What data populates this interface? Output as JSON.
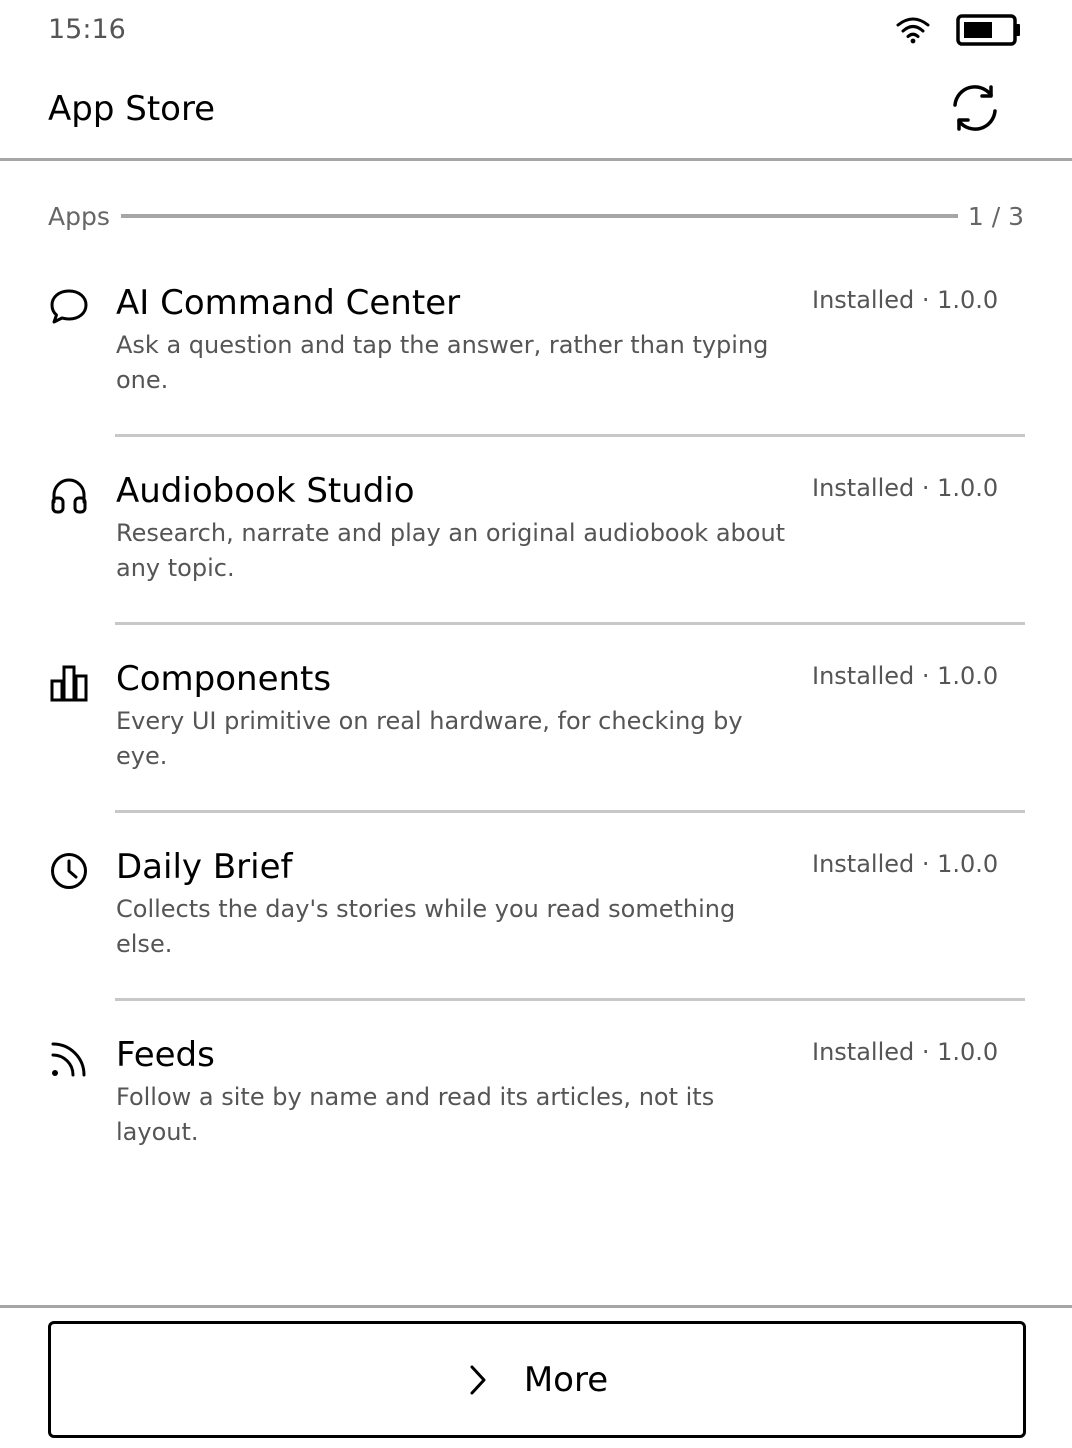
{
  "status_bar": {
    "time": "15:16",
    "wifi_icon": "wifi-icon",
    "battery_icon": "battery-icon"
  },
  "header": {
    "title": "App Store",
    "refresh_icon": "refresh-icon"
  },
  "section": {
    "label": "Apps",
    "page_indicator": "1 / 3"
  },
  "apps": [
    {
      "name": "AI Command Center",
      "description": "Ask a question and tap the answer, rather than typing one.",
      "status": "Installed · 1.0.0",
      "icon": "chat-bubble-icon"
    },
    {
      "name": "Audiobook Studio",
      "description": "Research, narrate and play an original audiobook about any topic.",
      "status": "Installed · 1.0.0",
      "icon": "headphones-icon"
    },
    {
      "name": "Components",
      "description": "Every UI primitive on real hardware, for checking by eye.",
      "status": "Installed · 1.0.0",
      "icon": "bar-chart-icon"
    },
    {
      "name": "Daily Brief",
      "description": "Collects the day's stories while you read something else.",
      "status": "Installed · 1.0.0",
      "icon": "clock-icon"
    },
    {
      "name": "Feeds",
      "description": "Follow a site by name and read its articles, not its layout.",
      "status": "Installed · 1.0.0",
      "icon": "rss-icon"
    }
  ],
  "footer": {
    "more_label": "More",
    "more_icon": "chevron-right-icon"
  }
}
